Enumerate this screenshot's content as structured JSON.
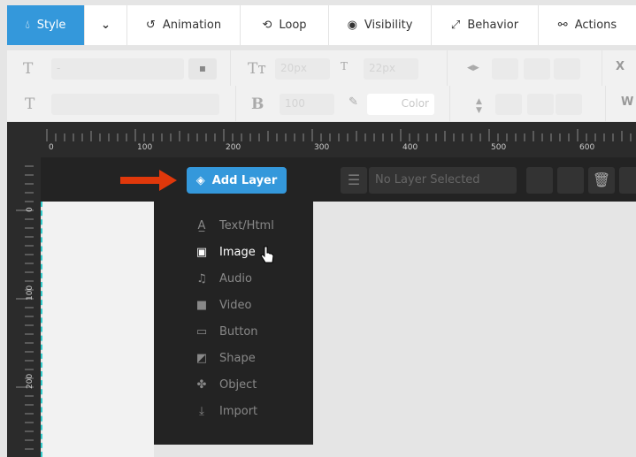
{
  "tabs": [
    {
      "label": "Style",
      "icon": "droplet-icon",
      "active": true
    },
    {
      "label": "",
      "icon": "chevron-down-icon"
    },
    {
      "label": "Animation",
      "icon": "history-icon"
    },
    {
      "label": "Loop",
      "icon": "loop-icon"
    },
    {
      "label": "Visibility",
      "icon": "eye-icon"
    },
    {
      "label": "Behavior",
      "icon": "expand-icon"
    },
    {
      "label": "Actions",
      "icon": "link-icon"
    }
  ],
  "toolbar": {
    "font_family_value": "-",
    "font_size": "20px",
    "line_height": "22px",
    "font_weight": "100",
    "color_label": "Color",
    "x_label": "X",
    "w_label": "W"
  },
  "ruler": {
    "labels": [
      "0",
      "100",
      "200",
      "300",
      "400",
      "500",
      "600"
    ],
    "v_labels": [
      "0",
      "100",
      "200"
    ]
  },
  "layer_bar": {
    "add_layer": "Add Layer",
    "selected": "No Layer Selected"
  },
  "menu": {
    "items": [
      {
        "label": "Text/Html",
        "icon": "text-icon"
      },
      {
        "label": "Image",
        "icon": "image-icon",
        "hover": true
      },
      {
        "label": "Audio",
        "icon": "music-icon"
      },
      {
        "label": "Video",
        "icon": "video-camera-icon"
      },
      {
        "label": "Button",
        "icon": "button-icon"
      },
      {
        "label": "Shape",
        "icon": "shape-icon"
      },
      {
        "label": "Object",
        "icon": "puzzle-icon"
      },
      {
        "label": "Import",
        "icon": "download-icon"
      }
    ]
  },
  "colors": {
    "accent": "#3498db",
    "arrow": "#e0380b",
    "dark": "#232323"
  }
}
